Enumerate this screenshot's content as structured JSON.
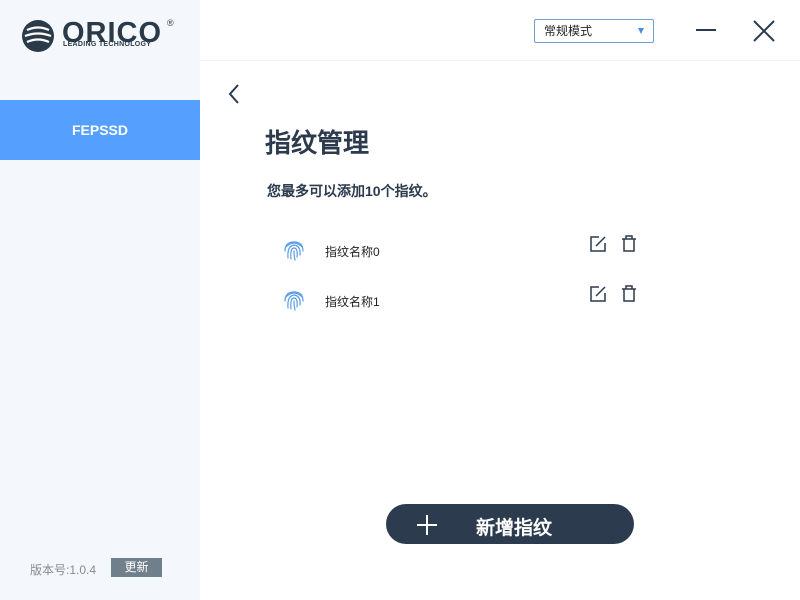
{
  "brand": {
    "name": "ORICO",
    "tagline": "LEADING TECHNOLOGY",
    "reg_mark": "®"
  },
  "sidebar": {
    "items": [
      {
        "label": "FEPSSD",
        "active": true
      }
    ],
    "version_label": "版本号:1.0.4",
    "update_label": "更新"
  },
  "header": {
    "mode_select": {
      "value": "常规模式"
    }
  },
  "main": {
    "title": "指纹管理",
    "subtitle": "您最多可以添加10个指纹。",
    "fingerprints": [
      {
        "name": "指纹名称0"
      },
      {
        "name": "指纹名称1"
      }
    ],
    "add_label": "新增指纹"
  },
  "colors": {
    "accent": "#55a0ff",
    "sidebar_bg": "#f4f8fc",
    "dark": "#2c3b4d",
    "update_btn": "#6f7f8b"
  },
  "icons": [
    "orico-logo-icon",
    "chevron-down-icon",
    "minimize-icon",
    "close-icon",
    "back-arrow-icon",
    "fingerprint-icon",
    "edit-icon",
    "trash-icon",
    "plus-icon"
  ]
}
